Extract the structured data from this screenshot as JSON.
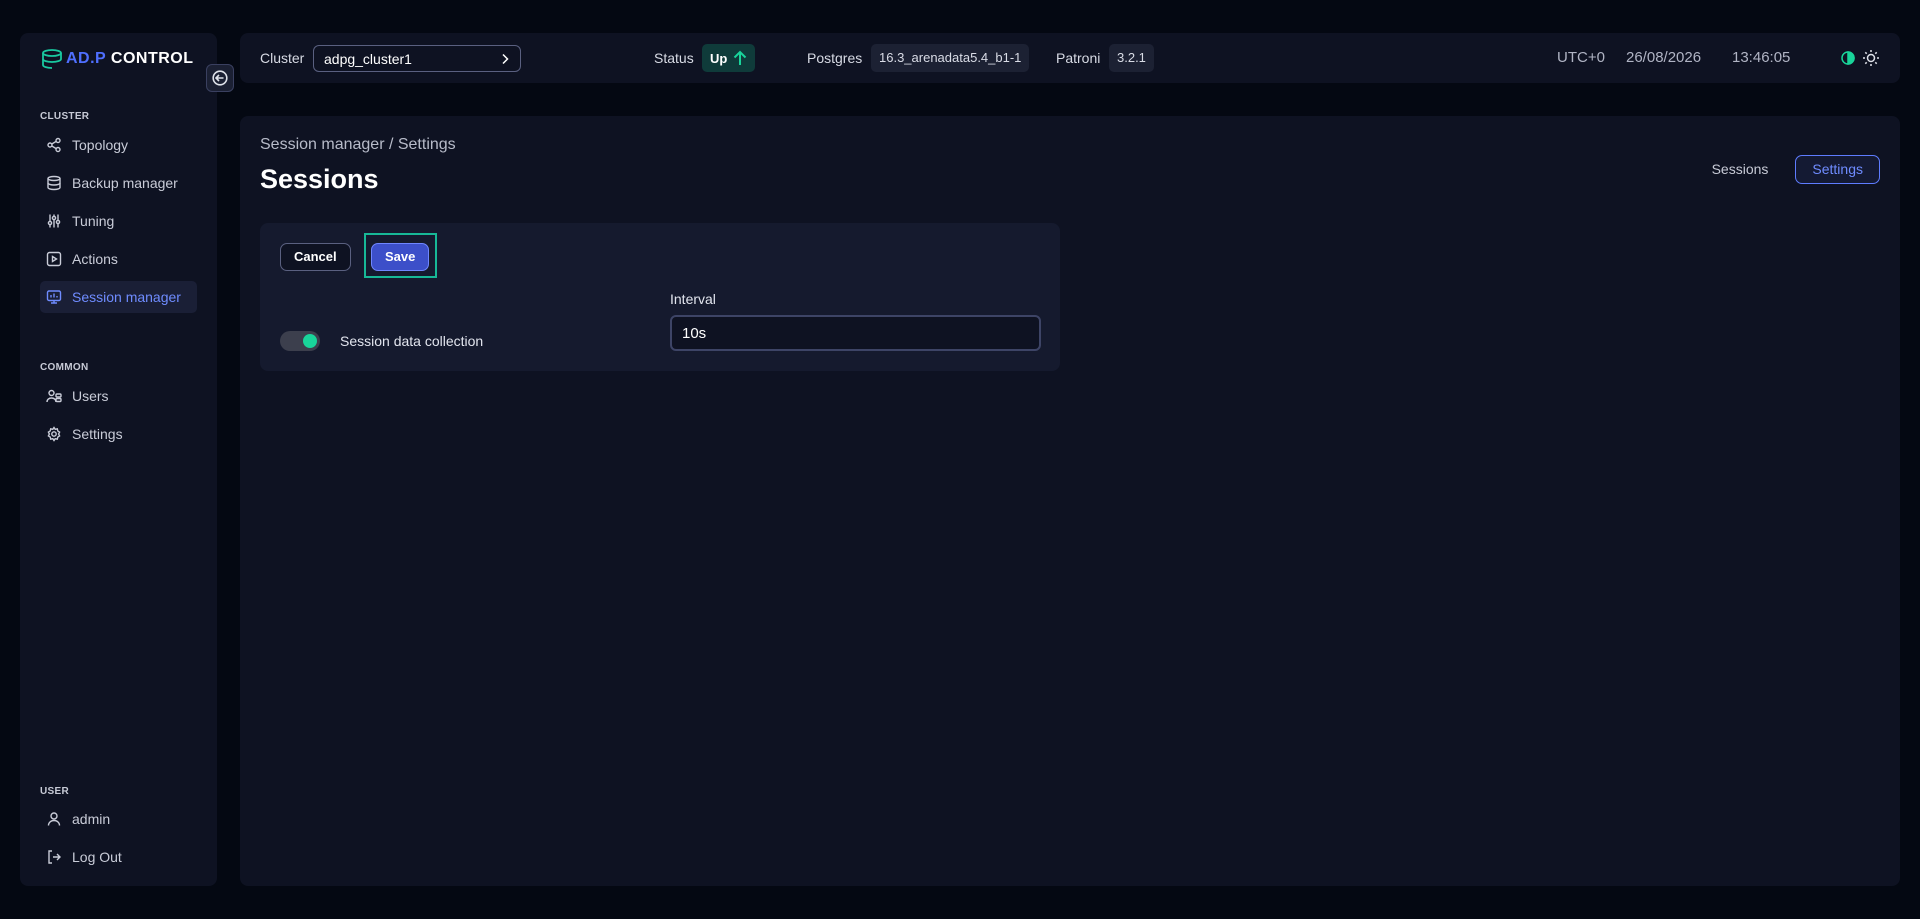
{
  "app": {
    "logo_part1": "AD.P",
    "logo_part2": "CONTROL"
  },
  "sidebar": {
    "cluster_section": "CLUSTER",
    "cluster_items": [
      {
        "label": "Topology",
        "icon": "topology-icon"
      },
      {
        "label": "Backup manager",
        "icon": "database-icon"
      },
      {
        "label": "Tuning",
        "icon": "sliders-icon"
      },
      {
        "label": "Actions",
        "icon": "play-square-icon"
      },
      {
        "label": "Session manager",
        "icon": "monitor-chart-icon",
        "active": true
      }
    ],
    "common_section": "COMMON",
    "common_items": [
      {
        "label": "Users",
        "icon": "users-icon"
      },
      {
        "label": "Settings",
        "icon": "gear-icon"
      }
    ],
    "user_section": "USER",
    "user_items": [
      {
        "label": "admin",
        "icon": "user-icon"
      },
      {
        "label": "Log Out",
        "icon": "logout-icon"
      }
    ]
  },
  "topbar": {
    "cluster_label": "Cluster",
    "cluster_value": "adpg_cluster1",
    "status_label": "Status",
    "status_value": "Up",
    "postgres_label": "Postgres",
    "postgres_version": "16.3_arenadata5.4_b1-1",
    "patroni_label": "Patroni",
    "patroni_version": "3.2.1",
    "timezone": "UTC+0",
    "date": "26/08/2026",
    "time": "13:46:05"
  },
  "main": {
    "breadcrumb": "Session manager / Settings",
    "title": "Sessions",
    "tabs": [
      {
        "label": "Sessions",
        "active": false
      },
      {
        "label": "Settings",
        "active": true
      }
    ],
    "cancel_label": "Cancel",
    "save_label": "Save",
    "toggle_label": "Session data collection",
    "toggle_on": true,
    "interval_label": "Interval",
    "interval_value": "10s"
  },
  "colors": {
    "accent": "#6f8cff",
    "status_up": "#19d49a",
    "background": "#040812",
    "panel": "#0e1222"
  }
}
